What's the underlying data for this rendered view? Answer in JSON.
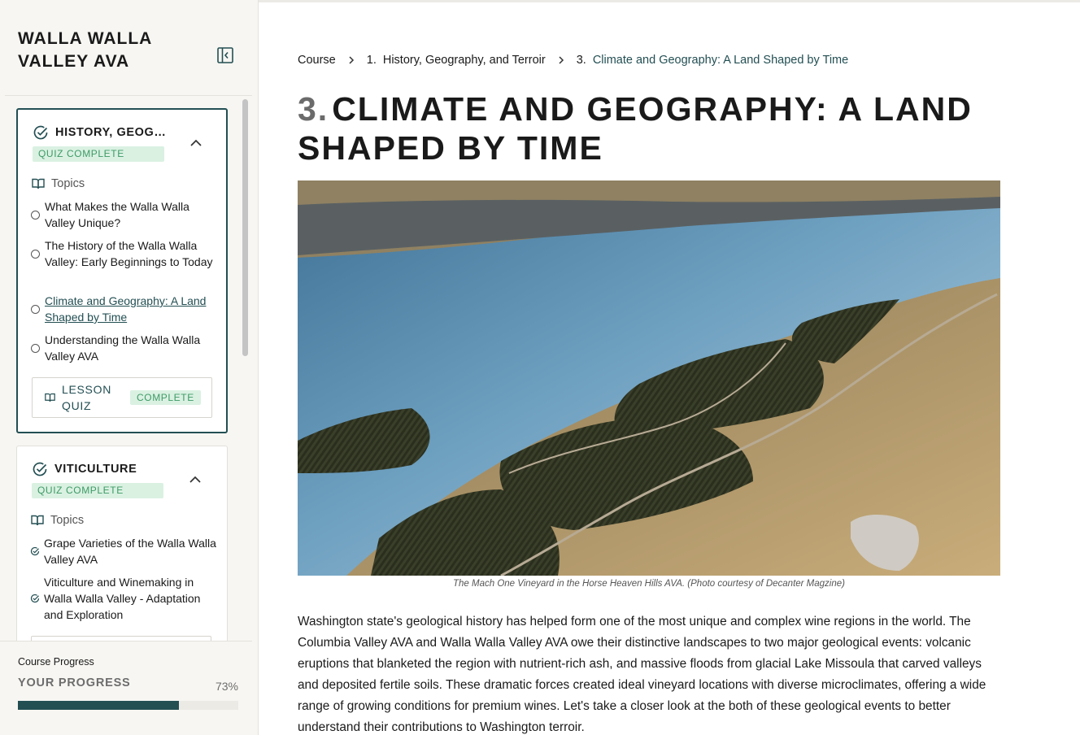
{
  "sidebar": {
    "course_title": "WALLA WALLA VALLEY AVA",
    "lessons": [
      {
        "title": "HISTORY, GEOG…",
        "quiz_status": "QUIZ COMPLETE",
        "topics_label": "Topics",
        "topics": [
          {
            "label": "What Makes the Walla Walla Valley Unique?",
            "status": "incomplete"
          },
          {
            "label": "The History of the Walla Walla Valley: Early Beginnings to Today",
            "status": "incomplete"
          },
          {
            "label": "Climate and Geography: A Land Shaped by Time",
            "status": "current"
          },
          {
            "label": "Understanding the Walla Walla Valley AVA",
            "status": "incomplete"
          }
        ],
        "lesson_quiz_label": "LESSON QUIZ",
        "lesson_quiz_status": "COMPLETE"
      },
      {
        "title": "VITICULTURE",
        "quiz_status": "QUIZ COMPLETE",
        "topics_label": "Topics",
        "topics": [
          {
            "label": "Grape Varieties of the Walla Walla Valley AVA",
            "status": "complete"
          },
          {
            "label": "Viticulture and Winemaking in Walla Walla Valley - Adaptation and Exploration",
            "status": "complete"
          }
        ]
      }
    ],
    "progress": {
      "caption": "Course Progress",
      "heading": "YOUR PROGRESS",
      "percent_label": "73%",
      "value": 0.73
    }
  },
  "main": {
    "breadcrumb": {
      "root": "Course",
      "lesson_num": "1.",
      "lesson": "History, Geography, and Terroir",
      "topic_num": "3.",
      "topic": "Climate and Geography: A Land Shaped by Time"
    },
    "title_number": "3.",
    "title": "CLIMATE AND GEOGRAPHY: A LAND SHAPED BY TIME",
    "image_caption": "The Mach One Vineyard in the Horse Heaven Hills AVA. (Photo courtesy of Decanter Magzine)",
    "body": "Washington state's geological history has helped form one of the most unique and complex wine regions in the world. The Columbia Valley AVA and Walla Walla Valley AVA owe their distinctive landscapes to two major geological events: volcanic eruptions that blanketed the region with nutrient-rich ash, and massive floods from glacial Lake Missoula that carved valleys and deposited fertile soils. These dramatic forces created ideal vineyard locations with diverse microclimates, offering a wide range of growing conditions for premium wines. Let's take a closer look at the both of these geological events to better understand their contributions to Washington terroir."
  },
  "colors": {
    "accent": "#234f53",
    "badge_bg": "#daf1e2",
    "badge_text": "#3e9a66",
    "sidebar_bg": "#f7f6f2"
  }
}
